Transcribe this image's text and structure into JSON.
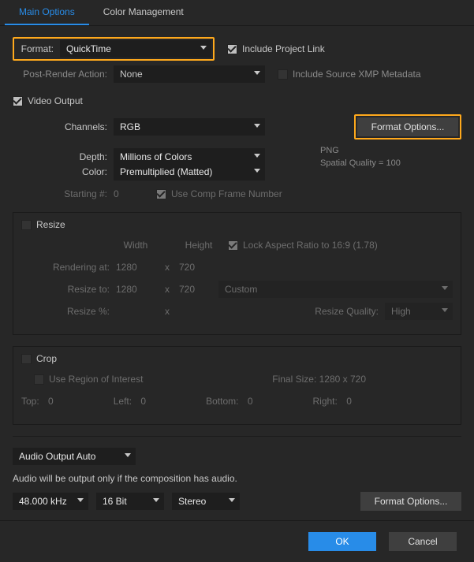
{
  "tabs": {
    "main": "Main Options",
    "color": "Color Management"
  },
  "format": {
    "label": "Format:",
    "value": "QuickTime"
  },
  "postRender": {
    "label": "Post-Render Action:",
    "value": "None"
  },
  "includeProjectLink": "Include Project Link",
  "includeXMP": "Include Source XMP Metadata",
  "videoOutput": "Video Output",
  "channels": {
    "label": "Channels:",
    "value": "RGB"
  },
  "depth": {
    "label": "Depth:",
    "value": "Millions of Colors"
  },
  "color": {
    "label": "Color:",
    "value": "Premultiplied (Matted)"
  },
  "starting": {
    "label": "Starting #:",
    "value": "0"
  },
  "useCompFrame": "Use Comp Frame Number",
  "codec": {
    "name": "PNG",
    "quality": "Spatial Quality = 100"
  },
  "formatOptions": "Format Options...",
  "resize": {
    "title": "Resize",
    "width": "Width",
    "height": "Height",
    "lock": "Lock Aspect Ratio to 16:9 (1.78)",
    "renderingAt": "Rendering at:",
    "renderW": "1280",
    "renderH": "720",
    "resizeTo": "Resize to:",
    "resizeW": "1280",
    "resizeH": "720",
    "preset": "Custom",
    "resizePct": "Resize %:",
    "quality": "Resize Quality:",
    "qualityVal": "High",
    "x": "x"
  },
  "crop": {
    "title": "Crop",
    "useROI": "Use Region of Interest",
    "finalSize": "Final Size: 1280 x 720",
    "top": "Top:",
    "left": "Left:",
    "bottom": "Bottom:",
    "right": "Right:",
    "zero": "0"
  },
  "audio": {
    "mode": "Audio Output Auto",
    "note": "Audio will be output only if the composition has audio.",
    "rate": "48.000 kHz",
    "depth": "16 Bit",
    "channels": "Stereo",
    "formatOptions": "Format Options..."
  },
  "ok": "OK",
  "cancel": "Cancel"
}
